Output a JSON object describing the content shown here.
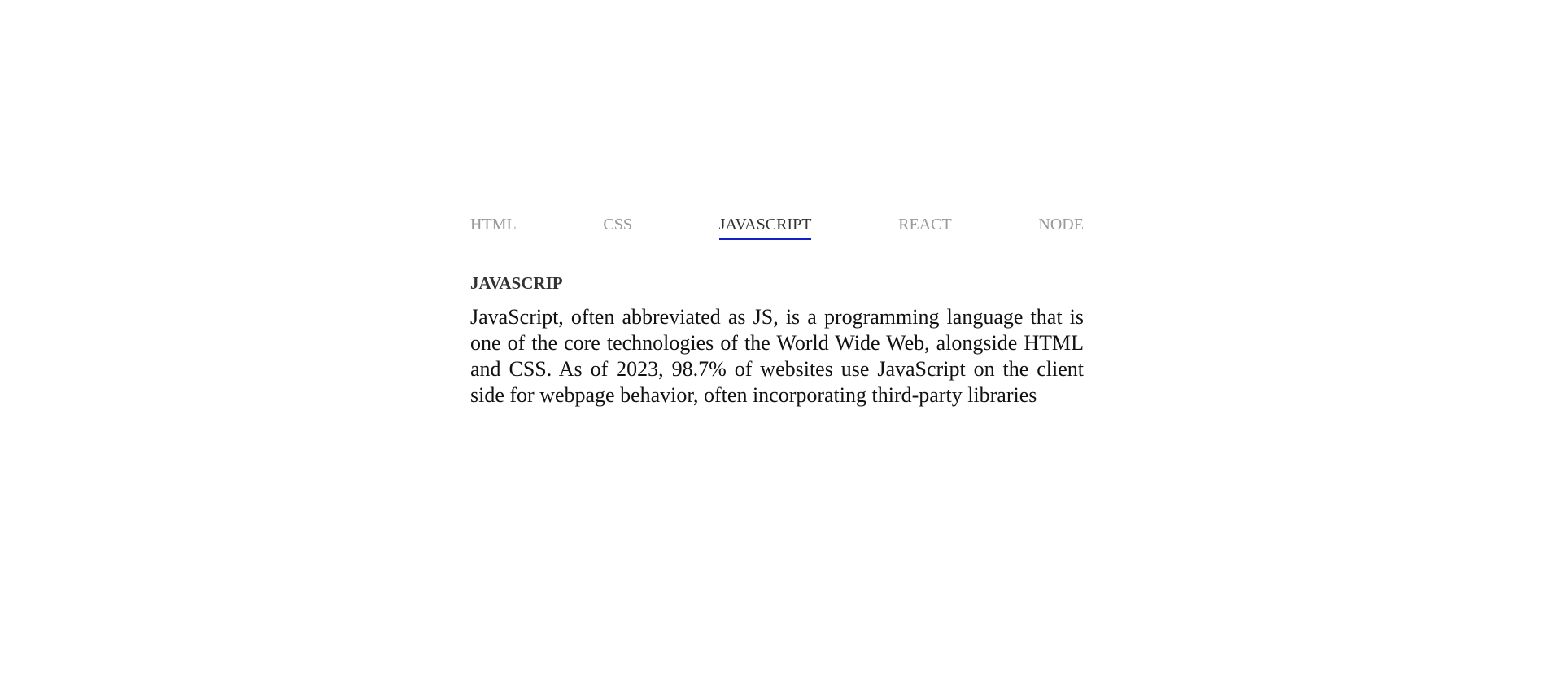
{
  "tabs": [
    {
      "label": "HTML",
      "active": false
    },
    {
      "label": "CSS",
      "active": false
    },
    {
      "label": "JAVASCRIPT",
      "active": true
    },
    {
      "label": "REACT",
      "active": false
    },
    {
      "label": "NODE",
      "active": false
    }
  ],
  "panel": {
    "title": "JAVASCRIP",
    "text": "JavaScript, often abbreviated as JS, is a programming language that is one of the core technologies of the World Wide Web, alongside HTML and CSS. As of 2023, 98.7% of websites use JavaScript on the client side for webpage behavior, often incorporating third-party libraries"
  },
  "colors": {
    "active_underline": "#1320c7",
    "inactive_tab": "#999999",
    "active_tab": "#333333"
  }
}
